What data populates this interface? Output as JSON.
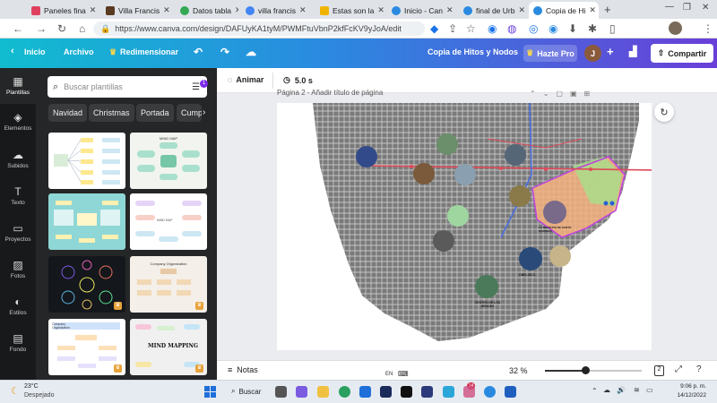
{
  "browser": {
    "tabs": [
      {
        "label": "Paneles fina",
        "color": "#e04060"
      },
      {
        "label": "Villa Francis",
        "color": "#5a3a20"
      },
      {
        "label": "Datos tabla",
        "color": "#34a853"
      },
      {
        "label": "villa francis",
        "color": "#4285f4"
      },
      {
        "label": "Estas son la",
        "color": "#f0b400"
      },
      {
        "label": "Inicio - Can",
        "color": "#2a8ae0"
      },
      {
        "label": "final de Urb",
        "color": "#2a8ae0"
      },
      {
        "label": "Copia de Hi",
        "color": "#2a8ae0"
      }
    ],
    "url": "https://www.canva.com/design/DAFUyKA1tyM/PWMFtuVbnP2kfFcKV9yJoA/edit"
  },
  "canva_header": {
    "home": "Inicio",
    "file": "Archivo",
    "resize": "Redimensionar",
    "doc_title": "Copia de Hitos y Nodos",
    "pro": "Hazte Pro",
    "avatar_letter": "J",
    "share": "Compartir"
  },
  "rail": [
    {
      "label": "Plantillas",
      "icon": "layout-icon"
    },
    {
      "label": "Elementos",
      "icon": "shapes-icon"
    },
    {
      "label": "Subidos",
      "icon": "upload-icon"
    },
    {
      "label": "Texto",
      "icon": "text-icon"
    },
    {
      "label": "Proyectos",
      "icon": "folder-icon"
    },
    {
      "label": "Fotos",
      "icon": "photo-icon"
    },
    {
      "label": "Estilos",
      "icon": "palette-icon"
    },
    {
      "label": "Fondo",
      "icon": "background-icon"
    }
  ],
  "panel": {
    "search_placeholder": "Buscar plantillas",
    "chips": [
      "Navidad",
      "Christmas",
      "Portada",
      "Cumpl"
    ],
    "templates": [
      {
        "title": "",
        "bg": "#ffffff"
      },
      {
        "title": "MIND MAP",
        "bg": "#f2f4ef"
      },
      {
        "title": "",
        "bg": "#8fd7d6"
      },
      {
        "title": "MIND MAP",
        "bg": "#ffffff"
      },
      {
        "title": "",
        "bg": "#14171c"
      },
      {
        "title": "Company Organization",
        "bg": "#f4efe8"
      },
      {
        "title": "Company Organization",
        "bg": "#ffffff"
      },
      {
        "title": "MIND MAPPING",
        "bg": "#f0f0f0"
      }
    ]
  },
  "editor": {
    "animate": "Animar",
    "duration": "5.0 s",
    "page_label": "Página 2 - Añadir título de página",
    "map_labels": {
      "label_a": "OBELISCO",
      "label_b": "CENTRO DE LOS HEROES",
      "label_c": "LA MEZQUITA DE SANTO DOMINGO"
    }
  },
  "bottom": {
    "notes": "Notas",
    "lang": "EN",
    "zoom": "32 %",
    "zoom_fraction": 0.42,
    "page_count": "2"
  },
  "taskbar": {
    "weather_temp": "23°C",
    "weather_desc": "Despejado",
    "search": "Buscar",
    "time": "9:06 p. m.",
    "date": "14/12/2022"
  }
}
